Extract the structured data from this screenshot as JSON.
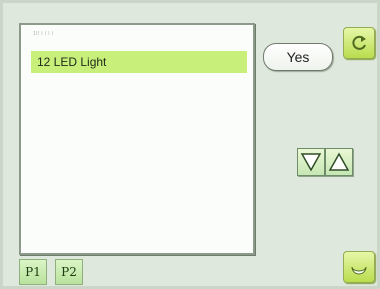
{
  "list": {
    "header": "1ll l l l l",
    "items": [
      {
        "label": "12 LED Light",
        "selected": true
      }
    ]
  },
  "actions": {
    "yes_label": "Yes"
  },
  "pages": {
    "p1_label": "P1",
    "p2_label": "P2"
  },
  "icons": {
    "refresh": "refresh-icon",
    "moon": "moon-icon",
    "down": "triangle-down-icon",
    "up": "triangle-up-icon"
  },
  "colors": {
    "background": "#dfe8dc",
    "selected_row": "#c7ef7a",
    "accent_button": "#b9dd4e"
  }
}
